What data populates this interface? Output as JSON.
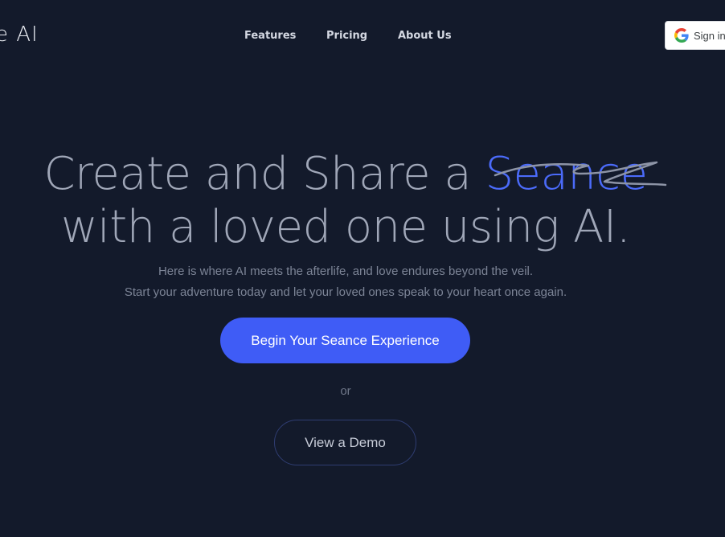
{
  "header": {
    "logo_text": "e AI",
    "nav": [
      {
        "label": "Features"
      },
      {
        "label": "Pricing"
      },
      {
        "label": "About Us"
      }
    ],
    "signin_label": "Sign in"
  },
  "hero": {
    "headline_line1_prefix": "Create and Share a ",
    "headline_accent": "Seance",
    "headline_line2": "with a loved one using AI.",
    "subtitle_line1": "Here is where AI meets the afterlife, and love endures beyond the veil.",
    "subtitle_line2": "Start your adventure today and let your loved ones speak to your heart once again.",
    "primary_cta": "Begin Your Seance Experience",
    "or_text": "or",
    "secondary_cta": "View a Demo"
  },
  "colors": {
    "background": "#131a2b",
    "accent": "#3f5cf6",
    "headline_text": "#a0a7b8"
  },
  "icons": {
    "signin": "google-icon",
    "scribble": "scribble-underline-icon"
  }
}
